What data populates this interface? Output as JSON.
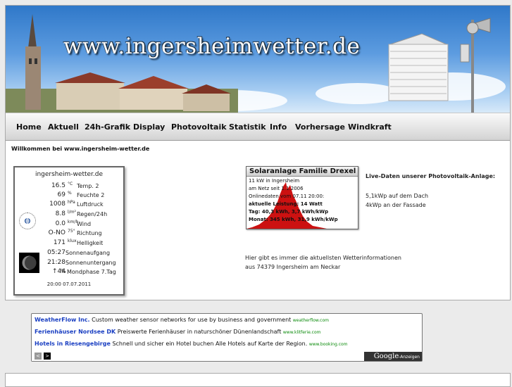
{
  "header": {
    "site_title": "www.ingersheimwetter.de"
  },
  "nav": [
    "Home",
    "Aktuell",
    "24h-Grafik",
    "Display",
    "Photovoltaik",
    "Statistik",
    "Info",
    "Vorhersage",
    "Windkraft"
  ],
  "welcome": "Willkommen bei www.ingersheim-wetter.de",
  "weather": {
    "heading": "ingersheim-wetter.de",
    "rows": [
      {
        "value": "16.5",
        "unit": "°C",
        "label": "Temp. 2"
      },
      {
        "value": "69",
        "unit": "%",
        "label": "Feuchte 2"
      },
      {
        "value": "1008",
        "unit": "hPa",
        "label": "Luftdruck"
      },
      {
        "value": "8.8",
        "unit": "l/m²",
        "label": "Regen/24h"
      },
      {
        "value": "0.0",
        "unit": "km/h",
        "label": "Wind"
      },
      {
        "value": "O-NO",
        "unit": "75°",
        "label": "Richtung"
      },
      {
        "value": "171",
        "unit": "klux",
        "label": "Helligkeit"
      },
      {
        "value": "05:27",
        "unit": "",
        "label": "Sonnenaufgang"
      },
      {
        "value": "21:28",
        "unit": "",
        "label": "Sonnenuntergang"
      },
      {
        "value": "↑44",
        "unit": "%",
        "label": "Mondphase 7.Tag"
      }
    ],
    "timestamp": "20:00  07.07.2011"
  },
  "solar": {
    "heading": "Solaranlage Familie Drexel",
    "lines": [
      "11 kW in Ingersheim",
      "am Netz seit 1.1.2006",
      "Onlinedaten vom 07.11 20:00:",
      "aktuelle Leistung: 14 Watt",
      "Tag: 40,3 kWh, 3,7 kWh/kWp",
      "Monat: 345 kWh, 31,9 kWh/kWp"
    ]
  },
  "live": {
    "title": "Live-Daten unserer Photovoltaik-Anlage:",
    "line1": "5,1kWp auf dem Dach",
    "line2": "4kWp an der Fassade"
  },
  "info": {
    "line1": "Hier gibt es immer die aktuellsten Wetterinformationen",
    "line2": "aus 74379 Ingersheim am Neckar"
  },
  "ads": [
    {
      "title": "WeatherFlow Inc.",
      "text": "Custom weather sensor networks for use by business and government",
      "url": "weatherflow.com"
    },
    {
      "title": "Ferienhäuser Nordsee DK",
      "text": "Preiswerte Ferienhäuser in naturschöner Dünenlandschaft",
      "url": "www.klitferie.com"
    },
    {
      "title": "Hotels in Riesengebirge",
      "text": "Schnell und sicher ein Hotel buchen Alle Hotels auf Karte der Region.",
      "url": "www.booking.com"
    }
  ],
  "ad_footer": {
    "prev": "<",
    "next": ">",
    "google": "Google",
    "anzeigen": "-Anzeigen"
  },
  "colors": {
    "nav_bg": "#d3d3d3",
    "ad_title": "#1a3fc2",
    "ad_url": "#0a8a0a",
    "solar_fill": "#cc1111"
  }
}
